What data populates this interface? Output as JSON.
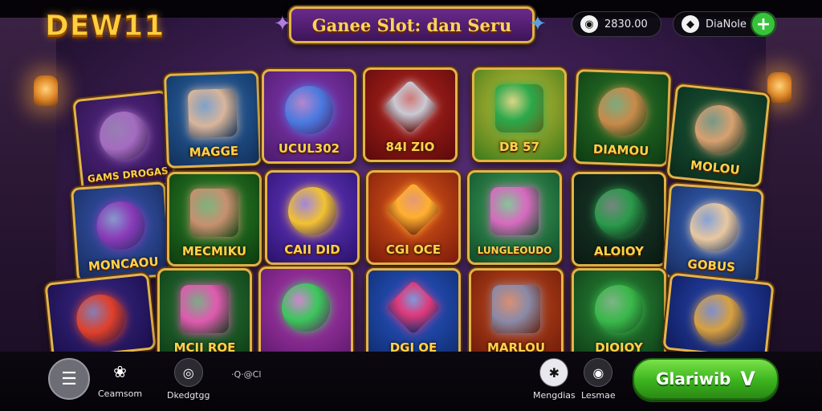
{
  "header": {
    "logo": "DEW11",
    "title": "Ganee Slot: dan Seru",
    "coins_value": "2830.00",
    "gems_label": "DiaNole"
  },
  "games": [
    {
      "label": "GAMS DROGAS",
      "colors": [
        "#5a2a8a",
        "#2a124a"
      ],
      "art": "#a46cc0"
    },
    {
      "label": "MAGGE",
      "colors": [
        "#2a6ab0",
        "#12305a"
      ],
      "art": "#d9b59a"
    },
    {
      "label": "UCUL302",
      "colors": [
        "#8a3ab8",
        "#4a1a6a"
      ],
      "art": "#4a7ae0"
    },
    {
      "label": "84I ZIO",
      "colors": [
        "#b8241e",
        "#5a0a0a"
      ],
      "art": "#c9c9d4"
    },
    {
      "label": "DB 57",
      "colors": [
        "#d8c23a",
        "#3a7a1a"
      ],
      "art": "#2aa84a"
    },
    {
      "label": "DIAMOU",
      "colors": [
        "#2a7a2a",
        "#0e3a12"
      ],
      "art": "#c88a4a"
    },
    {
      "label": "MOLOU",
      "colors": [
        "#1a5a3a",
        "#0a2a1a"
      ],
      "art": "#d8a070"
    },
    {
      "label": "MONCAOU",
      "colors": [
        "#3a5ab8",
        "#162a5a"
      ],
      "art": "#8a3ab8"
    },
    {
      "label": "MECMIKU",
      "colors": [
        "#2a8a2a",
        "#0e3a0e"
      ],
      "art": "#c89070"
    },
    {
      "label": "CAII DID",
      "colors": [
        "#6a3ad0",
        "#2a126a"
      ],
      "art": "#f2c230"
    },
    {
      "label": "CGI OCE",
      "colors": [
        "#e05a1a",
        "#7a1a0a"
      ],
      "art": "#ffb030"
    },
    {
      "label": "LUNGLEOUDO",
      "colors": [
        "#3aa85a",
        "#124a2a"
      ],
      "art": "#d86ac0"
    },
    {
      "label": "ALOIOY",
      "colors": [
        "#1a3a2a",
        "#0a1a12"
      ],
      "art": "#2a9a4a"
    },
    {
      "label": "GOBUS",
      "colors": [
        "#3a6ac8",
        "#162a5a"
      ],
      "art": "#e8c8a0"
    },
    {
      "label": "",
      "colors": [
        "#3a2a8a",
        "#1a0e4a"
      ],
      "art": "#e0402a"
    },
    {
      "label": "MCIJ ROE",
      "colors": [
        "#2a7a3a",
        "#0e3a14"
      ],
      "art": "#e05ab0"
    },
    {
      "label": "",
      "colors": [
        "#b83ab8",
        "#5a1a6a"
      ],
      "art": "#3ac85a"
    },
    {
      "label": "DGI OE",
      "colors": [
        "#2a5ad0",
        "#0e2a6a"
      ],
      "art": "#e03a7a"
    },
    {
      "label": "MARLOU",
      "colors": [
        "#c84a1a",
        "#6a1a0a"
      ],
      "art": "#8a8aa8"
    },
    {
      "label": "DIOIOY",
      "colors": [
        "#2a8a3a",
        "#0e3a14"
      ],
      "art": "#3ab84a"
    },
    {
      "label": "",
      "colors": [
        "#2a4ab8",
        "#0e1a5a"
      ],
      "art": "#d8a040"
    }
  ],
  "bottom_nav": {
    "item1": "Ceamsom",
    "item2": "Dkedgtgg",
    "item3": "·Q·@Cl",
    "item4": "Mengdias",
    "item5": "Lesmae",
    "play_label": "Glariwib",
    "play_chevron": "V"
  },
  "icons": {
    "coin": "coin-icon",
    "gem": "gem-icon",
    "plus": "plus-icon",
    "menu": "menu-icon",
    "gift": "gift-icon",
    "target": "target-icon",
    "star": "star-icon",
    "settings": "settings-icon"
  }
}
